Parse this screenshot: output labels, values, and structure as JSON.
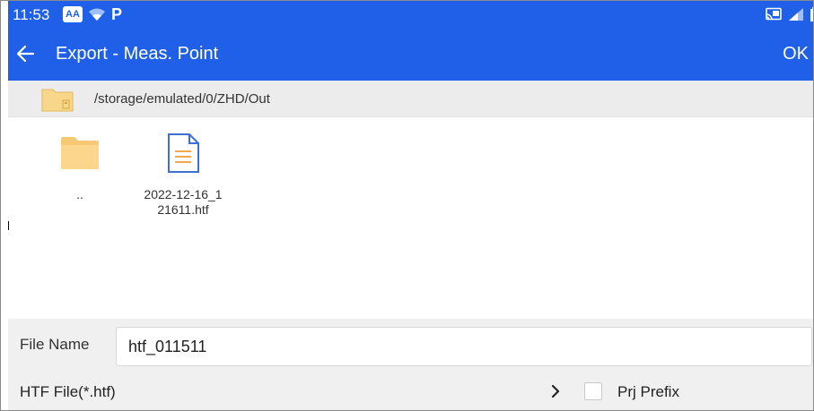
{
  "status_bar": {
    "time": "11:53",
    "p_icon": "P",
    "aa_icon": "AA",
    "icons": [
      "photos-icon",
      "wifi-icon",
      "parking-icon",
      "cast-icon",
      "signal-icon",
      "battery-icon"
    ]
  },
  "app_bar": {
    "title": "Export - Meas. Point",
    "ok_label": "OK",
    "color": "#2060e8"
  },
  "path_bar": {
    "path": "/storage/emulated/0/ZHD/Out"
  },
  "files": [
    {
      "name": "..",
      "type": "folder"
    },
    {
      "name": "2022-12-16_121611.htf",
      "type": "file"
    }
  ],
  "file_name": {
    "label": "File Name",
    "value": "htf_011511"
  },
  "file_type": {
    "label": "HTF File(*.htf)",
    "prj_prefix_label": "Prj Prefix",
    "prj_prefix_checked": false
  }
}
